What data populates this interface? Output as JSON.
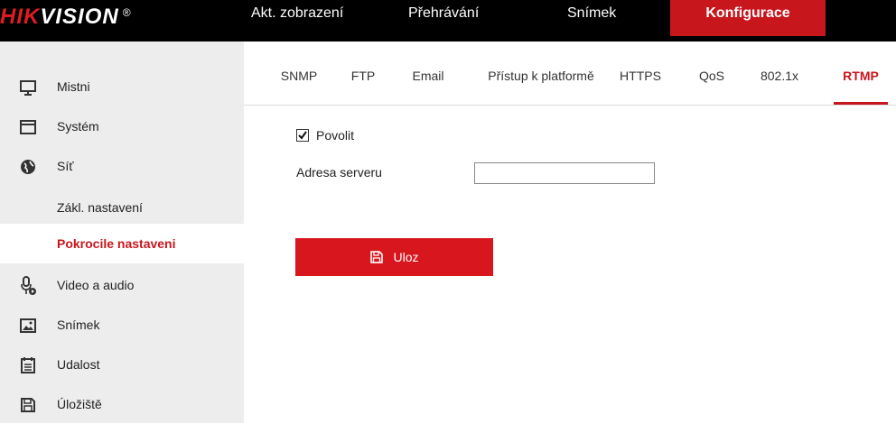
{
  "brand": {
    "logo_red": "HIK",
    "logo_white": "VISION",
    "reg": "®"
  },
  "topnav": [
    {
      "label": "Akt. zobrazení"
    },
    {
      "label": "Přehrávání"
    },
    {
      "label": "Snímek"
    },
    {
      "label": "Konfigurace",
      "active": true
    }
  ],
  "sidebar": {
    "items": [
      {
        "label": "Mistni",
        "icon": "monitor-icon"
      },
      {
        "label": "Systém",
        "icon": "window-icon"
      },
      {
        "label": "Síť",
        "icon": "globe-icon"
      },
      {
        "label": "Zákl. nastavení",
        "sub": true
      },
      {
        "label": "Pokrocile nastaveni",
        "sub": true,
        "active": true
      },
      {
        "label": "Video a audio",
        "icon": "microphone-icon"
      },
      {
        "label": "Snímek",
        "icon": "image-icon"
      },
      {
        "label": "Udalost",
        "icon": "calendar-icon"
      },
      {
        "label": "Úložiště",
        "icon": "floppy-icon"
      }
    ]
  },
  "tabs": [
    {
      "label": "SNMP"
    },
    {
      "label": "FTP"
    },
    {
      "label": "Email"
    },
    {
      "label": "Přístup k platformě"
    },
    {
      "label": "HTTPS"
    },
    {
      "label": "QoS"
    },
    {
      "label": "802.1x"
    },
    {
      "label": "RTMP",
      "active": true
    }
  ],
  "form": {
    "enable_label": "Povolit",
    "enable_checked": true,
    "server_label": "Adresa serveru",
    "server_value": "",
    "save_label": "Uloz"
  },
  "colors": {
    "accent": "#c8161d",
    "topbar": "#000000",
    "sidebar": "#ededed"
  }
}
